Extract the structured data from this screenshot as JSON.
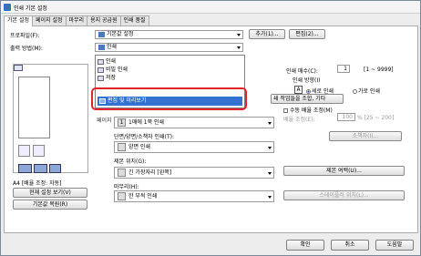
{
  "window": {
    "title": "인쇄 기본 설정"
  },
  "tabs": [
    "기본 설정",
    "페이지 설정",
    "마무리",
    "용지 공급원",
    "인쇄 품질"
  ],
  "profile": {
    "label": "프로파일(F):",
    "value": "기본값 설정",
    "add": "추가(1)...",
    "edit": "편집(2)..."
  },
  "output": {
    "label": "출력 방법(M):",
    "value": "인쇄",
    "menu": [
      "인쇄",
      "비밀 인쇄",
      "저장",
      "편집 및 미리보기"
    ]
  },
  "copies": {
    "label": "인쇄 매수(C):",
    "value": "1",
    "range": "[1 ~ 9999]",
    "orient_label": "인쇄 방향(I)",
    "portrait": "세로 인쇄",
    "landscape": "가로 인쇄"
  },
  "job_btn": "쇄 작업들을 조합, 기타",
  "manual_scale": "수동 배율 조정(M)",
  "scale_label": "배율 조정(E):",
  "scale_value": "100",
  "scale_range": "% [25 ~ 200]",
  "page_layout": "1매에 1쪽 인쇄",
  "duplex": {
    "label": "단면/양면/소책자 인쇄(T):",
    "value": "양면 인쇄"
  },
  "booklet_btn": "소책자(I)...",
  "binding": {
    "label": "제본 위치(G):",
    "value": "긴 가장자리 [왼쪽]"
  },
  "binding_btn": "제본 여백(U)...",
  "finishing": {
    "label": "마무리(H):",
    "value": "한 부씩 인쇄"
  },
  "staple_btn": "스테이플러 위치(L)...",
  "preview": {
    "paper": "A4 [배율 조정: 자동]",
    "view_btn": "현재 설정 보기(V)",
    "restore_btn": "기본값 복원(R)"
  },
  "footer": {
    "ok": "확인",
    "cancel": "취소",
    "help": "도움말"
  }
}
